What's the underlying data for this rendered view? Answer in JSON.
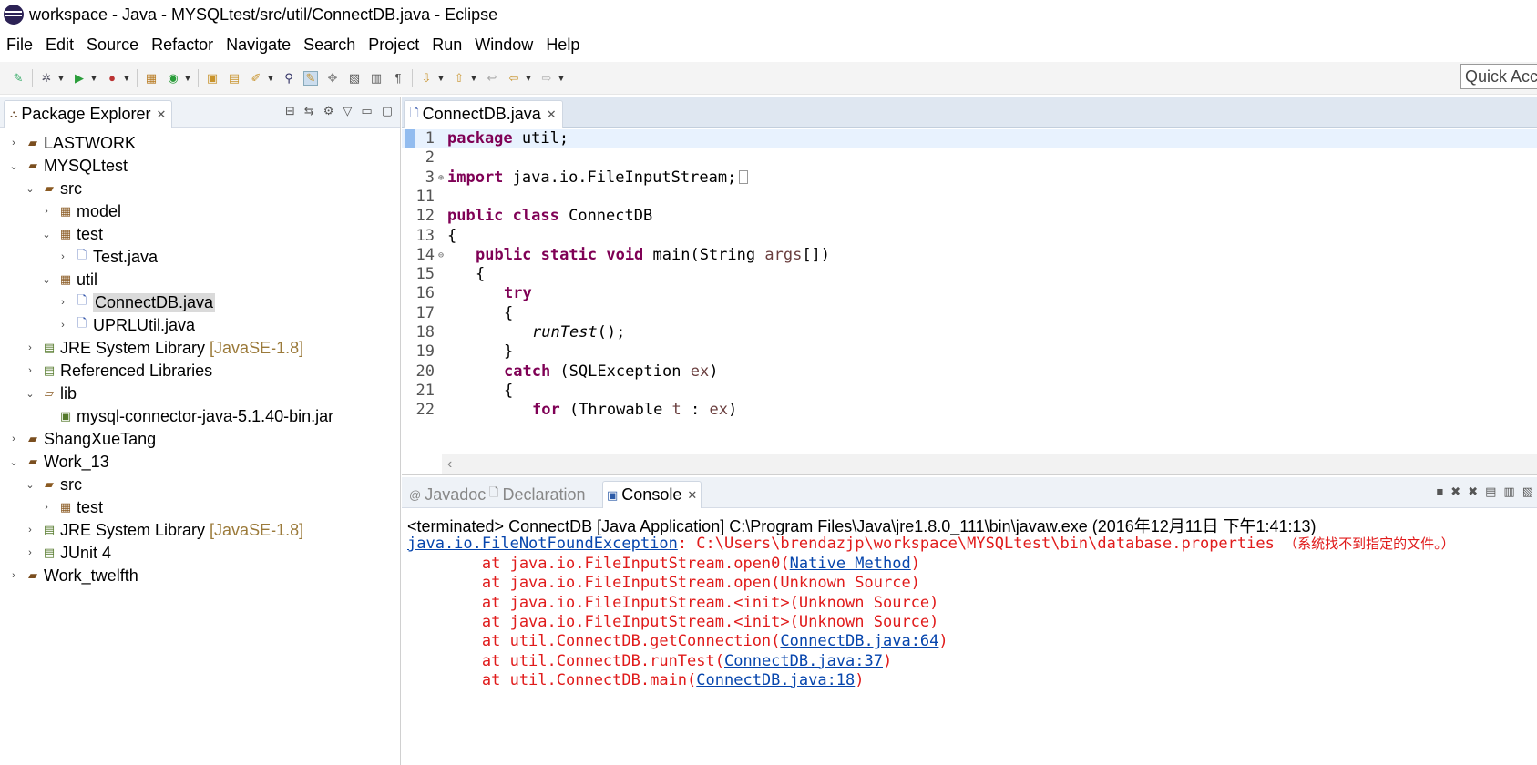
{
  "window": {
    "title": "workspace - Java - MYSQLtest/src/util/ConnectDB.java - Eclipse"
  },
  "menu": [
    "File",
    "Edit",
    "Source",
    "Refactor",
    "Navigate",
    "Search",
    "Project",
    "Run",
    "Window",
    "Help"
  ],
  "toolbar": {
    "quick_access": "Quick Access"
  },
  "explorer": {
    "tab_label": "Package Explorer",
    "tree": [
      {
        "label": "LASTWORK",
        "decor": "",
        "arrow": ">",
        "icon": "project-icon"
      },
      {
        "label": "MYSQLtest",
        "decor": "",
        "arrow": "v",
        "icon": "project-icon"
      },
      {
        "label": "src",
        "decor": "",
        "arrow": "v",
        "icon": "source-folder-icon"
      },
      {
        "label": "model",
        "decor": "",
        "arrow": ">",
        "icon": "package-icon"
      },
      {
        "label": "test",
        "decor": "",
        "arrow": "v",
        "icon": "package-icon"
      },
      {
        "label": "Test.java",
        "decor": "",
        "arrow": ">",
        "icon": "java-file-icon"
      },
      {
        "label": "util",
        "decor": "",
        "arrow": "v",
        "icon": "package-icon"
      },
      {
        "label": "ConnectDB.java",
        "decor": "",
        "arrow": ">",
        "icon": "java-file-icon"
      },
      {
        "label": "UPRLUtil.java",
        "decor": "",
        "arrow": ">",
        "icon": "java-file-icon"
      },
      {
        "label": "JRE System Library",
        "decor": "[JavaSE-1.8]",
        "arrow": ">",
        "icon": "library-icon"
      },
      {
        "label": "Referenced Libraries",
        "decor": "",
        "arrow": ">",
        "icon": "library-icon"
      },
      {
        "label": "lib",
        "decor": "",
        "arrow": "v",
        "icon": "folder-icon"
      },
      {
        "label": "mysql-connector-java-5.1.40-bin.jar",
        "decor": "",
        "arrow": "",
        "icon": "jar-icon"
      },
      {
        "label": "ShangXueTang",
        "decor": "",
        "arrow": ">",
        "icon": "project-icon"
      },
      {
        "label": "Work_13",
        "decor": "",
        "arrow": "v",
        "icon": "project-icon"
      },
      {
        "label": "src",
        "decor": "",
        "arrow": "v",
        "icon": "source-folder-icon"
      },
      {
        "label": "test",
        "decor": "",
        "arrow": ">",
        "icon": "package-icon"
      },
      {
        "label": "JRE System Library",
        "decor": "[JavaSE-1.8]",
        "arrow": ">",
        "icon": "library-icon"
      },
      {
        "label": "JUnit 4",
        "decor": "",
        "arrow": ">",
        "icon": "library-icon"
      },
      {
        "label": "Work_twelfth",
        "decor": "",
        "arrow": ">",
        "icon": "project-icon"
      }
    ]
  },
  "editor": {
    "tab_label": "ConnectDB.java",
    "lines": [
      {
        "n": "1",
        "text": "package util;"
      },
      {
        "n": "2",
        "text": ""
      },
      {
        "n": "3",
        "text": "import java.io.FileInputStream;"
      },
      {
        "n": "11",
        "text": ""
      },
      {
        "n": "12",
        "text": "public class ConnectDB"
      },
      {
        "n": "13",
        "text": "{"
      },
      {
        "n": "14",
        "text": "public static void main(String args[])"
      },
      {
        "n": "15",
        "text": "{"
      },
      {
        "n": "16",
        "text": "try"
      },
      {
        "n": "17",
        "text": "{"
      },
      {
        "n": "18",
        "text": "runTest();"
      },
      {
        "n": "19",
        "text": "}"
      },
      {
        "n": "20",
        "text": "catch (SQLException ex)"
      },
      {
        "n": "21",
        "text": "{"
      },
      {
        "n": "22",
        "text": "for (Throwable t : ex)"
      }
    ]
  },
  "console": {
    "tabs": [
      "Javadoc",
      "Declaration",
      "Console"
    ],
    "terminated": "<terminated> ConnectDB [Java Application] C:\\Program Files\\Java\\jre1.8.0_111\\bin\\javaw.exe (2016年12月11日 下午1:41:13)",
    "exception_link": "java.io.FileNotFoundException",
    "exception_msg": ": C:\\Users\\brendazjp\\workspace\\MYSQLtest\\bin\\database.properties ",
    "exception_cn": "（系统找不到指定的文件。）",
    "trace": [
      {
        "pre": "at java.io.FileInputStream.open0(",
        "link": "Native Method",
        "post": ")"
      },
      {
        "pre": "at java.io.FileInputStream.open(Unknown Source)",
        "link": "",
        "post": ""
      },
      {
        "pre": "at java.io.FileInputStream.<init>(Unknown Source)",
        "link": "",
        "post": ""
      },
      {
        "pre": "at java.io.FileInputStream.<init>(Unknown Source)",
        "link": "",
        "post": ""
      },
      {
        "pre": "at util.ConnectDB.getConnection(",
        "link": "ConnectDB.java:64",
        "post": ")"
      },
      {
        "pre": "at util.ConnectDB.runTest(",
        "link": "ConnectDB.java:37",
        "post": ")"
      },
      {
        "pre": "at util.ConnectDB.main(",
        "link": "ConnectDB.java:18",
        "post": ")"
      }
    ]
  }
}
